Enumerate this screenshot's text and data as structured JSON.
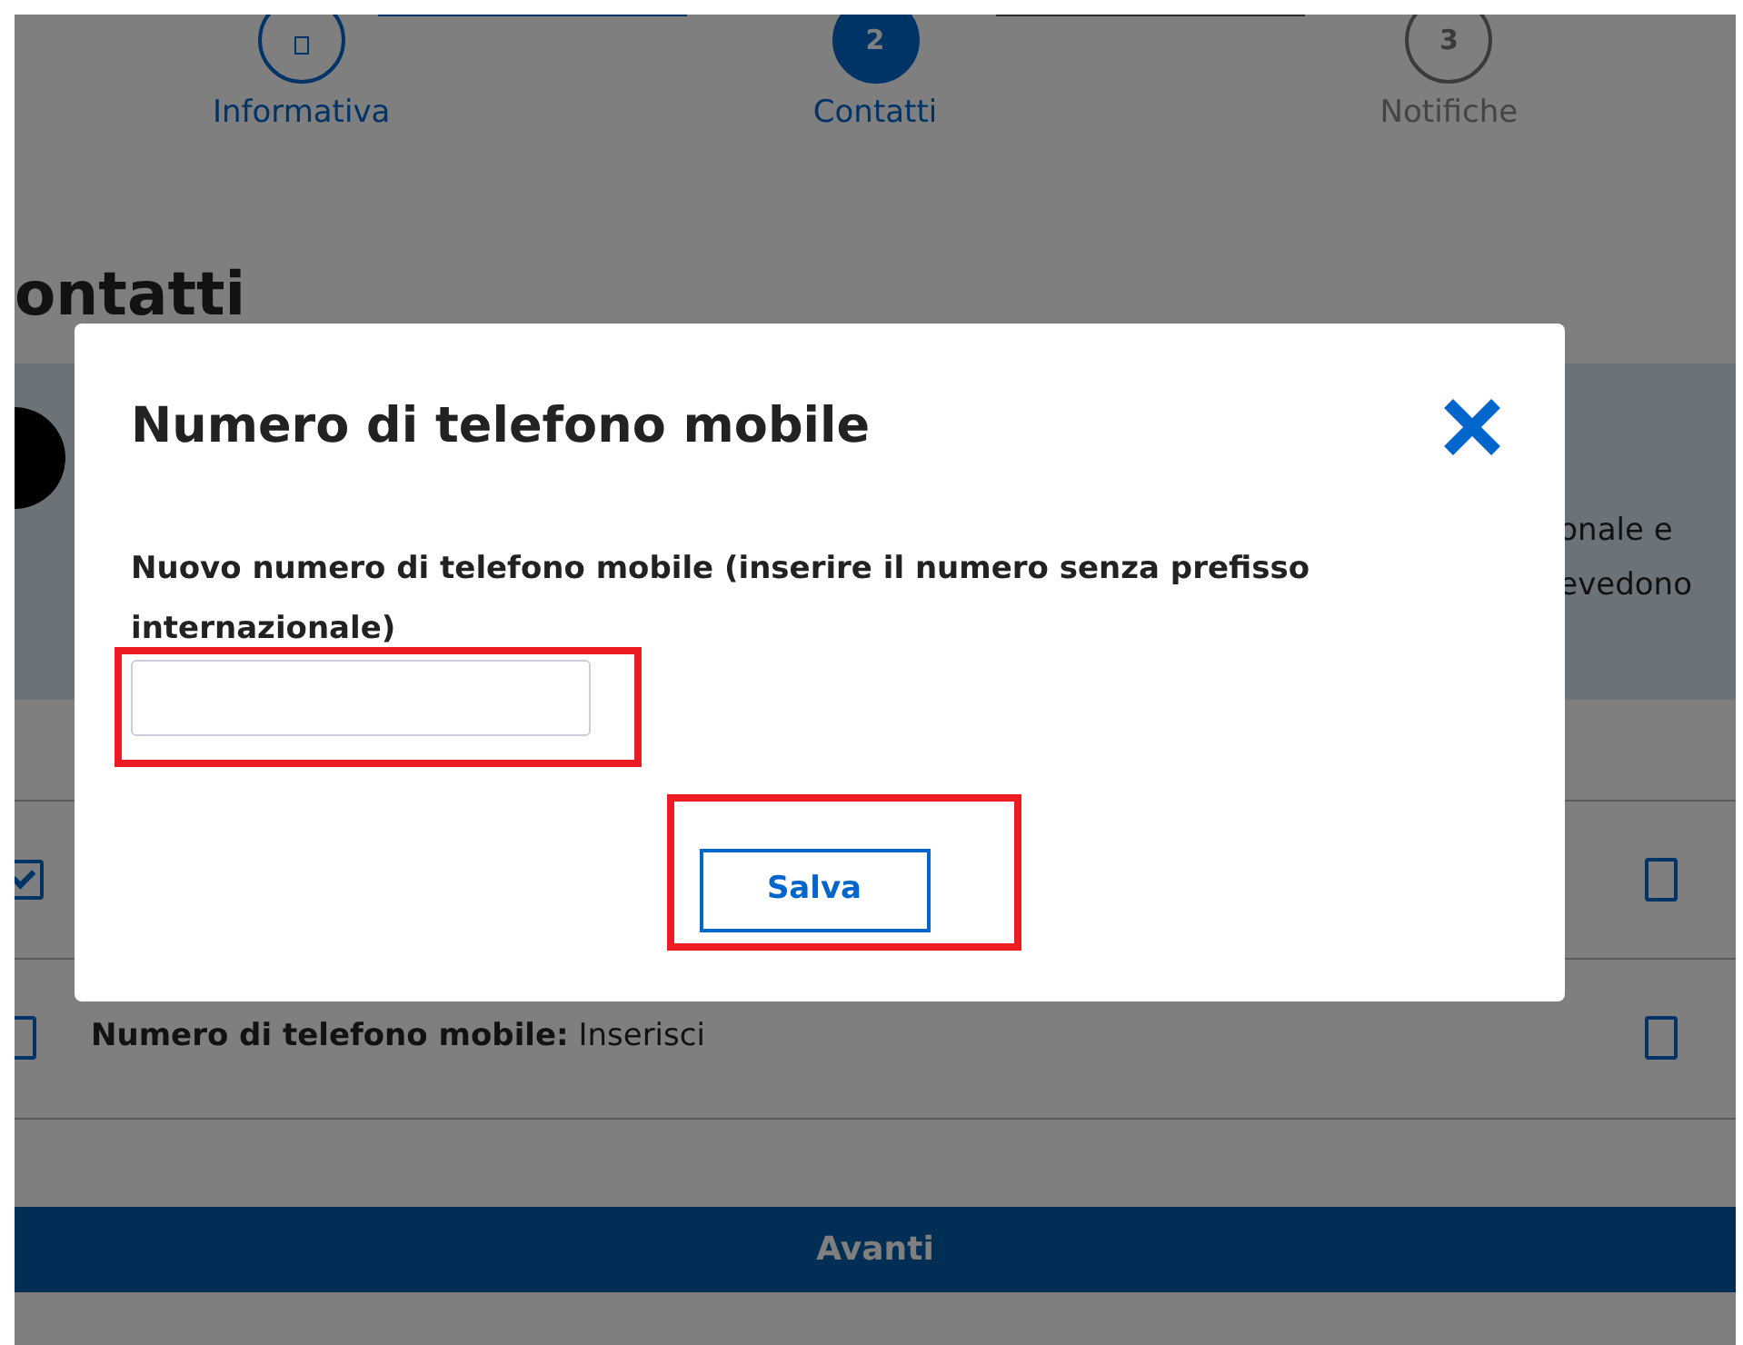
{
  "steps": [
    {
      "label": "Informativa",
      "selected": false,
      "done": true
    },
    {
      "number": "2",
      "label": "Contatti",
      "selected": true
    },
    {
      "number": "3",
      "label": "Notifiche",
      "selected": false,
      "done": false
    }
  ],
  "page_title": "ontatti",
  "info_lines": [
    "onale e",
    "evedono"
  ],
  "contact_rows": [
    {
      "left_checked": true,
      "right_checked": false
    },
    {
      "label": "Numero di telefono mobile:",
      "value": "Inserisci",
      "left_checked": false,
      "right_checked": false
    }
  ],
  "next_button": "Avanti",
  "modal": {
    "title": "Numero di telefono mobile",
    "label": "Nuovo numero di telefono mobile (inserire il numero senza prefisso internazionale)",
    "field": {
      "highlighted": true
    },
    "save_button": {
      "label": "Salva",
      "highlighted": true
    }
  }
}
